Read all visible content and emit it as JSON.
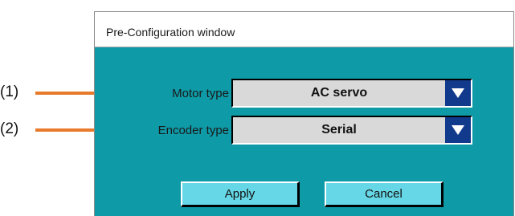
{
  "window": {
    "title": "Pre-Configuration window"
  },
  "fields": [
    {
      "label": "Motor type",
      "value": "AC servo",
      "callout": "(1)"
    },
    {
      "label": "Encoder type",
      "value": "Serial",
      "callout": "(2)"
    }
  ],
  "buttons": {
    "apply_label": "Apply",
    "cancel_label": "Cancel"
  },
  "colors": {
    "window_background": "#0e9aa7",
    "button_face": "#66d7e6",
    "dropdown_arrow": "#123a8c",
    "callout_line": "#e87a2b"
  },
  "icons": {
    "dropdown": "chevron-down-icon"
  }
}
